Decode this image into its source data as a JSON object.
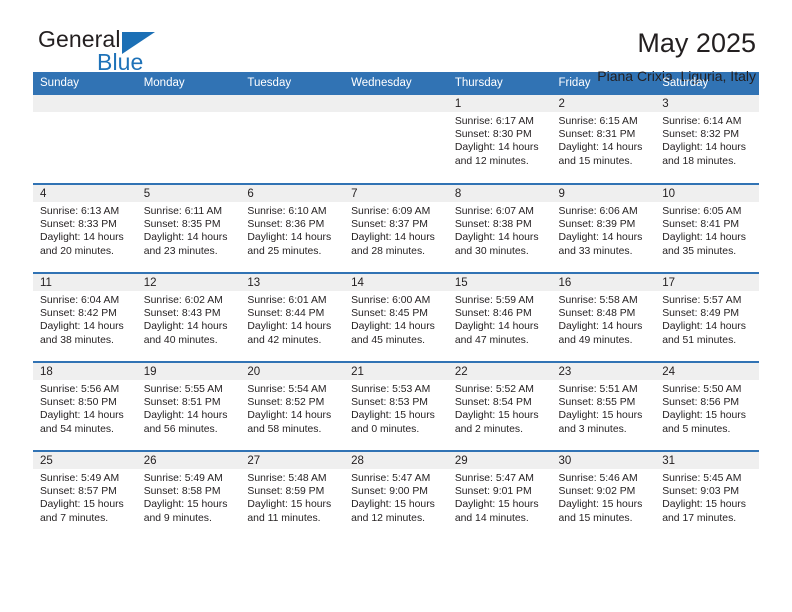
{
  "brand": {
    "name_top": "General",
    "name_bottom": "Blue",
    "accent_color": "#1b6fb5",
    "triangle_icon": "triangle-icon"
  },
  "header": {
    "title": "May 2025",
    "subtitle": "Piana Crixia, Liguria, Italy"
  },
  "calendar": {
    "header_bg": "#3173b4",
    "daynum_bg": "#efefef",
    "weekdays": [
      "Sunday",
      "Monday",
      "Tuesday",
      "Wednesday",
      "Thursday",
      "Friday",
      "Saturday"
    ],
    "weeks": [
      [
        {
          "day": "",
          "empty": true
        },
        {
          "day": "",
          "empty": true
        },
        {
          "day": "",
          "empty": true
        },
        {
          "day": "",
          "empty": true
        },
        {
          "day": "1",
          "sunrise": "Sunrise: 6:17 AM",
          "sunset": "Sunset: 8:30 PM",
          "daylight": "Daylight: 14 hours and 12 minutes."
        },
        {
          "day": "2",
          "sunrise": "Sunrise: 6:15 AM",
          "sunset": "Sunset: 8:31 PM",
          "daylight": "Daylight: 14 hours and 15 minutes."
        },
        {
          "day": "3",
          "sunrise": "Sunrise: 6:14 AM",
          "sunset": "Sunset: 8:32 PM",
          "daylight": "Daylight: 14 hours and 18 minutes."
        }
      ],
      [
        {
          "day": "4",
          "sunrise": "Sunrise: 6:13 AM",
          "sunset": "Sunset: 8:33 PM",
          "daylight": "Daylight: 14 hours and 20 minutes."
        },
        {
          "day": "5",
          "sunrise": "Sunrise: 6:11 AM",
          "sunset": "Sunset: 8:35 PM",
          "daylight": "Daylight: 14 hours and 23 minutes."
        },
        {
          "day": "6",
          "sunrise": "Sunrise: 6:10 AM",
          "sunset": "Sunset: 8:36 PM",
          "daylight": "Daylight: 14 hours and 25 minutes."
        },
        {
          "day": "7",
          "sunrise": "Sunrise: 6:09 AM",
          "sunset": "Sunset: 8:37 PM",
          "daylight": "Daylight: 14 hours and 28 minutes."
        },
        {
          "day": "8",
          "sunrise": "Sunrise: 6:07 AM",
          "sunset": "Sunset: 8:38 PM",
          "daylight": "Daylight: 14 hours and 30 minutes."
        },
        {
          "day": "9",
          "sunrise": "Sunrise: 6:06 AM",
          "sunset": "Sunset: 8:39 PM",
          "daylight": "Daylight: 14 hours and 33 minutes."
        },
        {
          "day": "10",
          "sunrise": "Sunrise: 6:05 AM",
          "sunset": "Sunset: 8:41 PM",
          "daylight": "Daylight: 14 hours and 35 minutes."
        }
      ],
      [
        {
          "day": "11",
          "sunrise": "Sunrise: 6:04 AM",
          "sunset": "Sunset: 8:42 PM",
          "daylight": "Daylight: 14 hours and 38 minutes."
        },
        {
          "day": "12",
          "sunrise": "Sunrise: 6:02 AM",
          "sunset": "Sunset: 8:43 PM",
          "daylight": "Daylight: 14 hours and 40 minutes."
        },
        {
          "day": "13",
          "sunrise": "Sunrise: 6:01 AM",
          "sunset": "Sunset: 8:44 PM",
          "daylight": "Daylight: 14 hours and 42 minutes."
        },
        {
          "day": "14",
          "sunrise": "Sunrise: 6:00 AM",
          "sunset": "Sunset: 8:45 PM",
          "daylight": "Daylight: 14 hours and 45 minutes."
        },
        {
          "day": "15",
          "sunrise": "Sunrise: 5:59 AM",
          "sunset": "Sunset: 8:46 PM",
          "daylight": "Daylight: 14 hours and 47 minutes."
        },
        {
          "day": "16",
          "sunrise": "Sunrise: 5:58 AM",
          "sunset": "Sunset: 8:48 PM",
          "daylight": "Daylight: 14 hours and 49 minutes."
        },
        {
          "day": "17",
          "sunrise": "Sunrise: 5:57 AM",
          "sunset": "Sunset: 8:49 PM",
          "daylight": "Daylight: 14 hours and 51 minutes."
        }
      ],
      [
        {
          "day": "18",
          "sunrise": "Sunrise: 5:56 AM",
          "sunset": "Sunset: 8:50 PM",
          "daylight": "Daylight: 14 hours and 54 minutes."
        },
        {
          "day": "19",
          "sunrise": "Sunrise: 5:55 AM",
          "sunset": "Sunset: 8:51 PM",
          "daylight": "Daylight: 14 hours and 56 minutes."
        },
        {
          "day": "20",
          "sunrise": "Sunrise: 5:54 AM",
          "sunset": "Sunset: 8:52 PM",
          "daylight": "Daylight: 14 hours and 58 minutes."
        },
        {
          "day": "21",
          "sunrise": "Sunrise: 5:53 AM",
          "sunset": "Sunset: 8:53 PM",
          "daylight": "Daylight: 15 hours and 0 minutes."
        },
        {
          "day": "22",
          "sunrise": "Sunrise: 5:52 AM",
          "sunset": "Sunset: 8:54 PM",
          "daylight": "Daylight: 15 hours and 2 minutes."
        },
        {
          "day": "23",
          "sunrise": "Sunrise: 5:51 AM",
          "sunset": "Sunset: 8:55 PM",
          "daylight": "Daylight: 15 hours and 3 minutes."
        },
        {
          "day": "24",
          "sunrise": "Sunrise: 5:50 AM",
          "sunset": "Sunset: 8:56 PM",
          "daylight": "Daylight: 15 hours and 5 minutes."
        }
      ],
      [
        {
          "day": "25",
          "sunrise": "Sunrise: 5:49 AM",
          "sunset": "Sunset: 8:57 PM",
          "daylight": "Daylight: 15 hours and 7 minutes."
        },
        {
          "day": "26",
          "sunrise": "Sunrise: 5:49 AM",
          "sunset": "Sunset: 8:58 PM",
          "daylight": "Daylight: 15 hours and 9 minutes."
        },
        {
          "day": "27",
          "sunrise": "Sunrise: 5:48 AM",
          "sunset": "Sunset: 8:59 PM",
          "daylight": "Daylight: 15 hours and 11 minutes."
        },
        {
          "day": "28",
          "sunrise": "Sunrise: 5:47 AM",
          "sunset": "Sunset: 9:00 PM",
          "daylight": "Daylight: 15 hours and 12 minutes."
        },
        {
          "day": "29",
          "sunrise": "Sunrise: 5:47 AM",
          "sunset": "Sunset: 9:01 PM",
          "daylight": "Daylight: 15 hours and 14 minutes."
        },
        {
          "day": "30",
          "sunrise": "Sunrise: 5:46 AM",
          "sunset": "Sunset: 9:02 PM",
          "daylight": "Daylight: 15 hours and 15 minutes."
        },
        {
          "day": "31",
          "sunrise": "Sunrise: 5:45 AM",
          "sunset": "Sunset: 9:03 PM",
          "daylight": "Daylight: 15 hours and 17 minutes."
        }
      ]
    ]
  }
}
